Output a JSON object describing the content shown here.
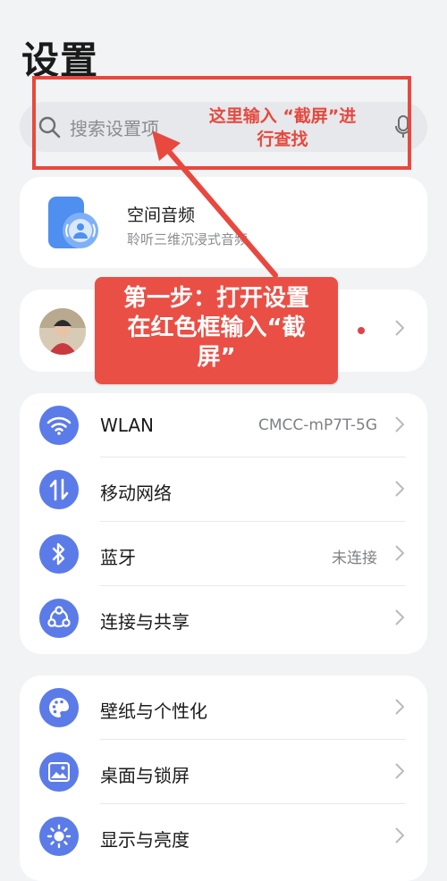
{
  "page_title": "设置",
  "search": {
    "placeholder": "搜索设置项"
  },
  "audio_card": {
    "title": "空间音频",
    "subtitle": "聆听三维沉浸式音频"
  },
  "groups": {
    "network": [
      {
        "label": "WLAN",
        "value": "CMCC-mP7T-5G",
        "icon": "wifi-icon"
      },
      {
        "label": "移动网络",
        "value": "",
        "icon": "mobile-data-icon"
      },
      {
        "label": "蓝牙",
        "value": "未连接",
        "icon": "bluetooth-icon"
      },
      {
        "label": "连接与共享",
        "value": "",
        "icon": "share-icon"
      }
    ],
    "display": [
      {
        "label": "壁纸与个性化",
        "icon": "palette-icon"
      },
      {
        "label": "桌面与锁屏",
        "icon": "image-icon"
      },
      {
        "label": "显示与亮度",
        "icon": "brightness-icon"
      }
    ]
  },
  "annotations": {
    "search_hint_line1": "这里输入 “截屏”进",
    "search_hint_line2": "行查找",
    "step_line1": "第一步：打开设置",
    "step_line2": "在红色框输入“截",
    "step_line3": "屏”"
  },
  "colors": {
    "accent": "#5b7be8",
    "annotation_red": "#e8483e",
    "badge_dot": "#e0424d"
  }
}
